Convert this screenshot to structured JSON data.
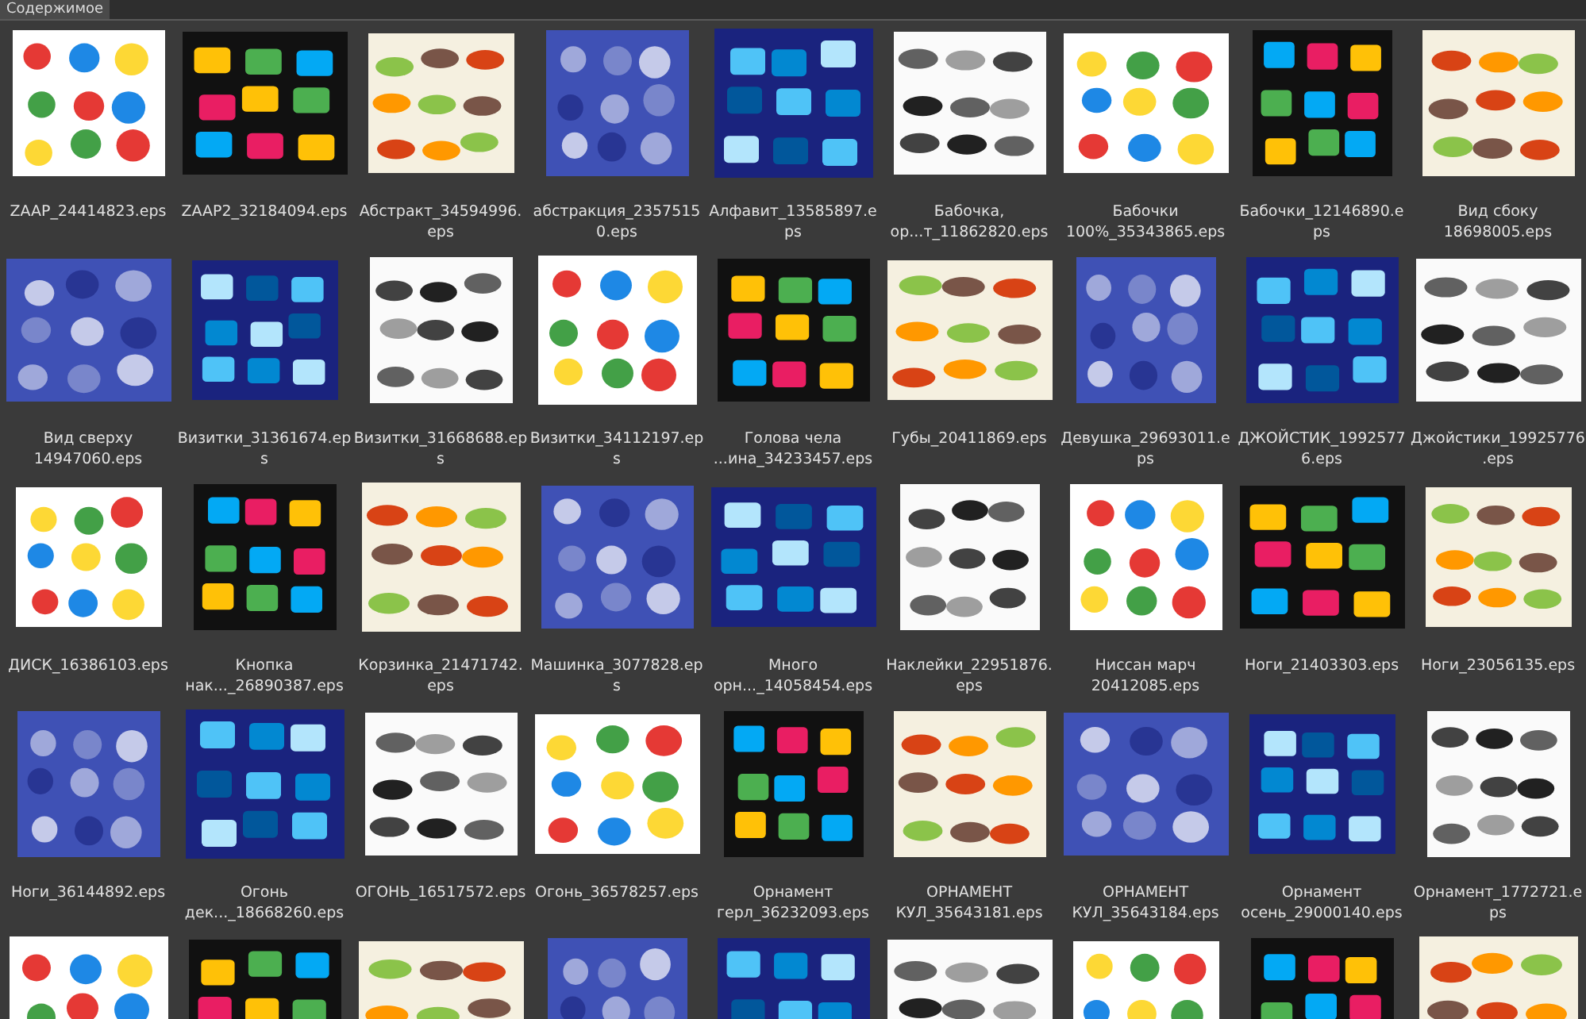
{
  "panel": {
    "tab": "Содержимое"
  },
  "files": [
    {
      "kind": "picture",
      "lines": [
        "ZAAP_24414823.eps"
      ]
    },
    {
      "kind": "picture",
      "lines": [
        "ZAAP2_32184094.eps"
      ]
    },
    {
      "kind": "picture",
      "lines": [
        "Абстракт_34594996.",
        "eps"
      ]
    },
    {
      "kind": "picture",
      "lines": [
        "абстракция_2357515",
        "0.eps"
      ]
    },
    {
      "kind": "picture",
      "lines": [
        "Алфавит_13585897.e",
        "ps"
      ]
    },
    {
      "kind": "picture",
      "lines": [
        "Бабочка,",
        "ор...т_11862820.eps"
      ]
    },
    {
      "kind": "picture",
      "lines": [
        "Бабочки",
        "100%_35343865.eps"
      ]
    },
    {
      "kind": "picture",
      "lines": [
        "Бабочки_12146890.e",
        "ps"
      ]
    },
    {
      "kind": "picture",
      "lines": [
        "Вид сбоку",
        "18698005.eps"
      ]
    },
    {
      "kind": "picture",
      "lines": [
        "Вид сверху",
        "14947060.eps"
      ]
    },
    {
      "kind": "picture",
      "lines": [
        "Визитки_31361674.ep",
        "s"
      ]
    },
    {
      "kind": "picture",
      "lines": [
        "Визитки_31668688.ep",
        "s"
      ]
    },
    {
      "kind": "picture",
      "lines": [
        "Визитки_34112197.ep",
        "s"
      ]
    },
    {
      "kind": "picture",
      "lines": [
        "Голова чела",
        "...ина_34233457.eps"
      ]
    },
    {
      "kind": "picture",
      "lines": [
        "Губы_20411869.eps"
      ]
    },
    {
      "kind": "picture",
      "lines": [
        "Девушка_29693011.e",
        "ps"
      ]
    },
    {
      "kind": "picture",
      "lines": [
        "ДЖОЙСТИК_1992577",
        "6.eps"
      ]
    },
    {
      "kind": "picture",
      "lines": [
        "Джойстики_19925776",
        ".eps"
      ]
    },
    {
      "kind": "picture",
      "lines": [
        "ДИСК_16386103.eps"
      ]
    },
    {
      "kind": "picture",
      "lines": [
        "Кнопка",
        "нак..._26890387.eps"
      ]
    },
    {
      "kind": "picture",
      "lines": [
        "Корзинка_21471742.",
        "eps"
      ]
    },
    {
      "kind": "picture",
      "lines": [
        "Машинка_3077828.ep",
        "s"
      ]
    },
    {
      "kind": "picture",
      "lines": [
        "Много",
        "орн..._14058454.eps"
      ]
    },
    {
      "kind": "picture",
      "lines": [
        "Наклейки_22951876.",
        "eps"
      ]
    },
    {
      "kind": "picture",
      "lines": [
        "Ниссан марч",
        "20412085.eps"
      ]
    },
    {
      "kind": "picture",
      "lines": [
        "Ноги_21403303.eps"
      ]
    },
    {
      "kind": "picture",
      "lines": [
        "Ноги_23056135.eps"
      ]
    },
    {
      "kind": "picture",
      "lines": [
        "Ноги_36144892.eps"
      ]
    },
    {
      "kind": "picture",
      "lines": [
        "Огонь",
        "дек..._18668260.eps"
      ]
    },
    {
      "kind": "picture",
      "lines": [
        "ОГОНЬ_16517572.eps"
      ]
    },
    {
      "kind": "picture",
      "lines": [
        "Огонь_36578257.eps"
      ]
    },
    {
      "kind": "picture",
      "lines": [
        "Орнамент",
        "герл_36232093.eps"
      ]
    },
    {
      "kind": "picture",
      "lines": [
        "ОРНАМЕНТ",
        "КУЛ_35643181.eps"
      ]
    },
    {
      "kind": "picture",
      "lines": [
        "ОРНАМЕНТ",
        "КУЛ_35643184.eps"
      ]
    },
    {
      "kind": "picture",
      "lines": [
        "Орнамент",
        "осень_29000140.eps"
      ]
    },
    {
      "kind": "picture",
      "lines": [
        "Орнамент_1772721.e",
        "ps"
      ]
    },
    {
      "kind": "picture"
    },
    {
      "kind": "picture"
    },
    {
      "kind": "picture"
    },
    {
      "kind": "picture"
    },
    {
      "kind": "picture"
    },
    {
      "kind": "picture"
    },
    {
      "kind": "picture"
    },
    {
      "kind": "picture"
    },
    {
      "kind": "picture"
    }
  ]
}
